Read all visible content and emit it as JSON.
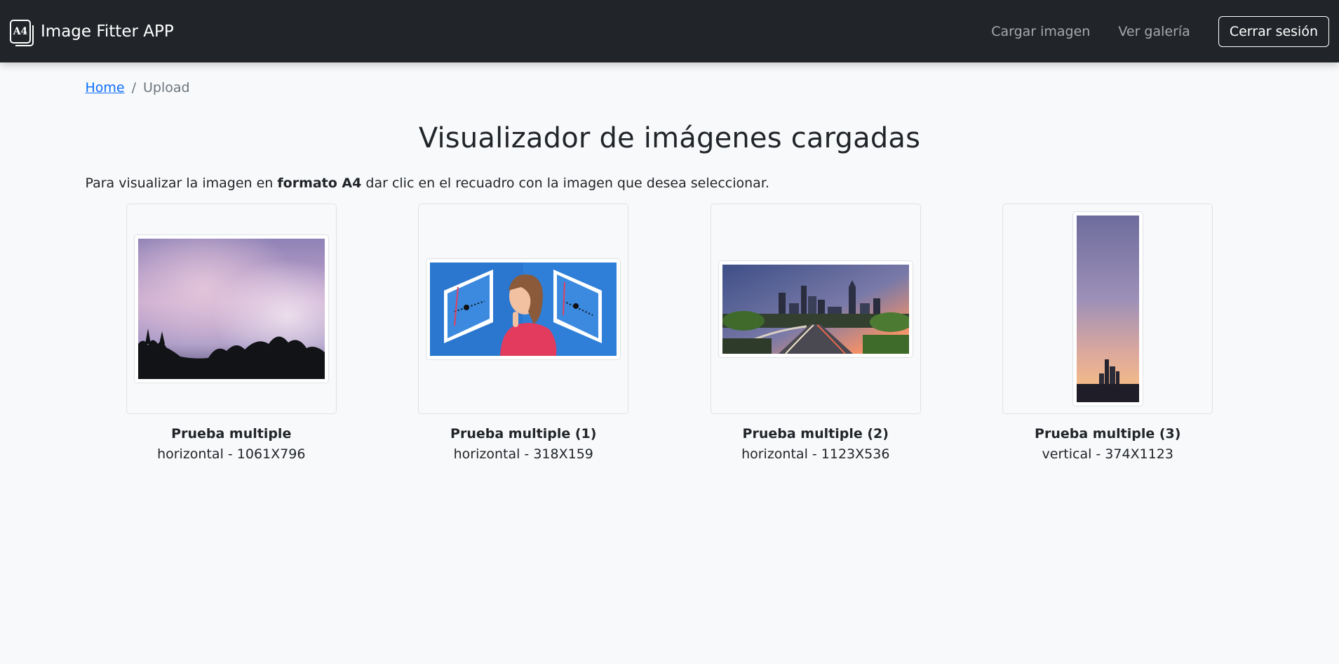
{
  "navbar": {
    "brand_icon_text": "A4",
    "brand_name": "Image Fitter APP",
    "links": [
      "Cargar imagen",
      "Ver galería"
    ],
    "logout_label": "Cerrar sesión",
    "colors": {
      "background": "#212529",
      "link": "rgba(255,255,255,0.6)"
    }
  },
  "breadcrumb": {
    "home": "Home",
    "separator": "/",
    "current": "Upload"
  },
  "page": {
    "title": "Visualizador de imágenes cargadas",
    "intro_before": "Para visualizar la imagen en ",
    "intro_bold": "formato A4",
    "intro_after": " dar clic en el recuadro con la imagen que desea seleccionar."
  },
  "images": [
    {
      "title": "Prueba multiple",
      "info": "horizontal - 1061X796",
      "scene": "purple cloudy sky over trees"
    },
    {
      "title": "Prueba multiple (1)",
      "info": "horizontal - 318X159",
      "scene": "illustration of woman looking at screens"
    },
    {
      "title": "Prueba multiple (2)",
      "info": "horizontal - 1123X536",
      "scene": "city skyline with highway at dusk"
    },
    {
      "title": "Prueba multiple (3)",
      "info": "vertical - 374X1123",
      "scene": "tall sunset sky over city"
    }
  ],
  "colors": {
    "page_bg": "#f8f9fa",
    "link": "#0d6efd",
    "muted": "#6c757d"
  }
}
